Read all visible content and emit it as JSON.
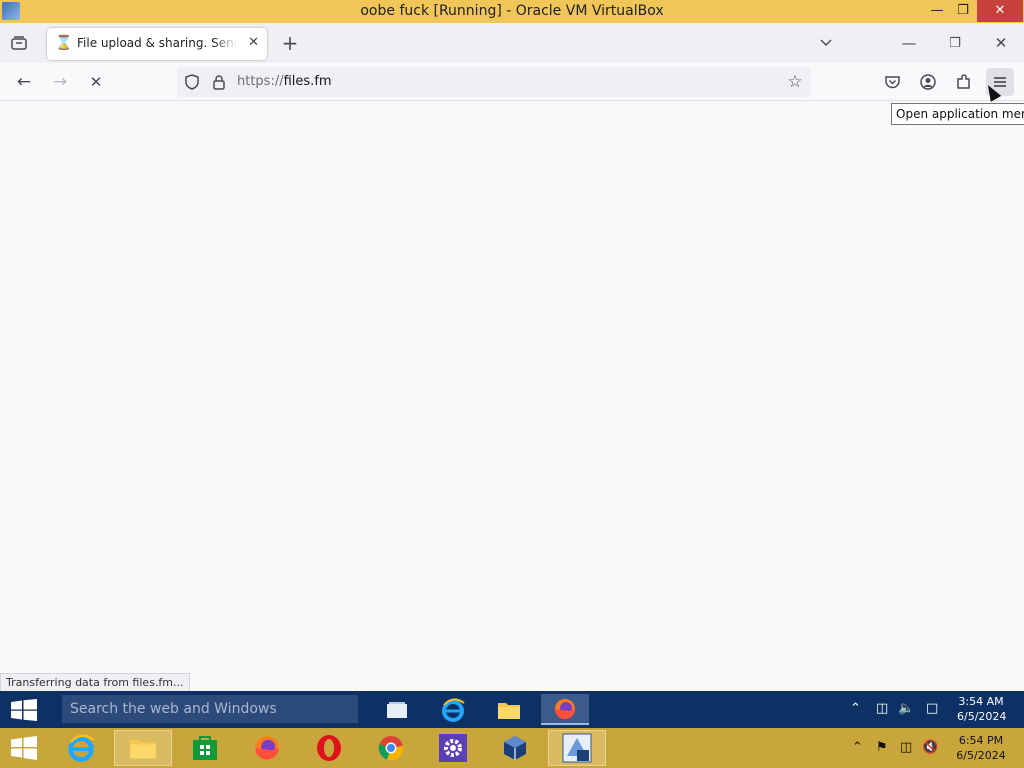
{
  "vbox": {
    "title": "oobe fuck [Running] - Oracle VM VirtualBox"
  },
  "browser": {
    "tab": {
      "title": "File upload & sharing. Send large files"
    },
    "url": {
      "scheme": "https://",
      "host": "files.fm"
    },
    "tooltip": "Open application menu",
    "status": "Transferring data from files.fm..."
  },
  "guest_taskbar": {
    "search_placeholder": "Search the web and Windows",
    "time": "3:54 AM",
    "date": "6/5/2024",
    "apps": [
      "task-view",
      "internet-explorer",
      "file-explorer",
      "firefox"
    ]
  },
  "host_taskbar": {
    "time": "6:54 PM",
    "date": "6/5/2024",
    "apps": [
      "internet-explorer",
      "file-explorer",
      "store",
      "firefox",
      "opera",
      "chrome",
      "settings",
      "virtualbox",
      "virtualbox-vm"
    ]
  },
  "colors": {
    "vbox_titlebar": "#f0c659",
    "guest_taskbar": "#0d3164",
    "host_taskbar": "#c8a63c"
  }
}
